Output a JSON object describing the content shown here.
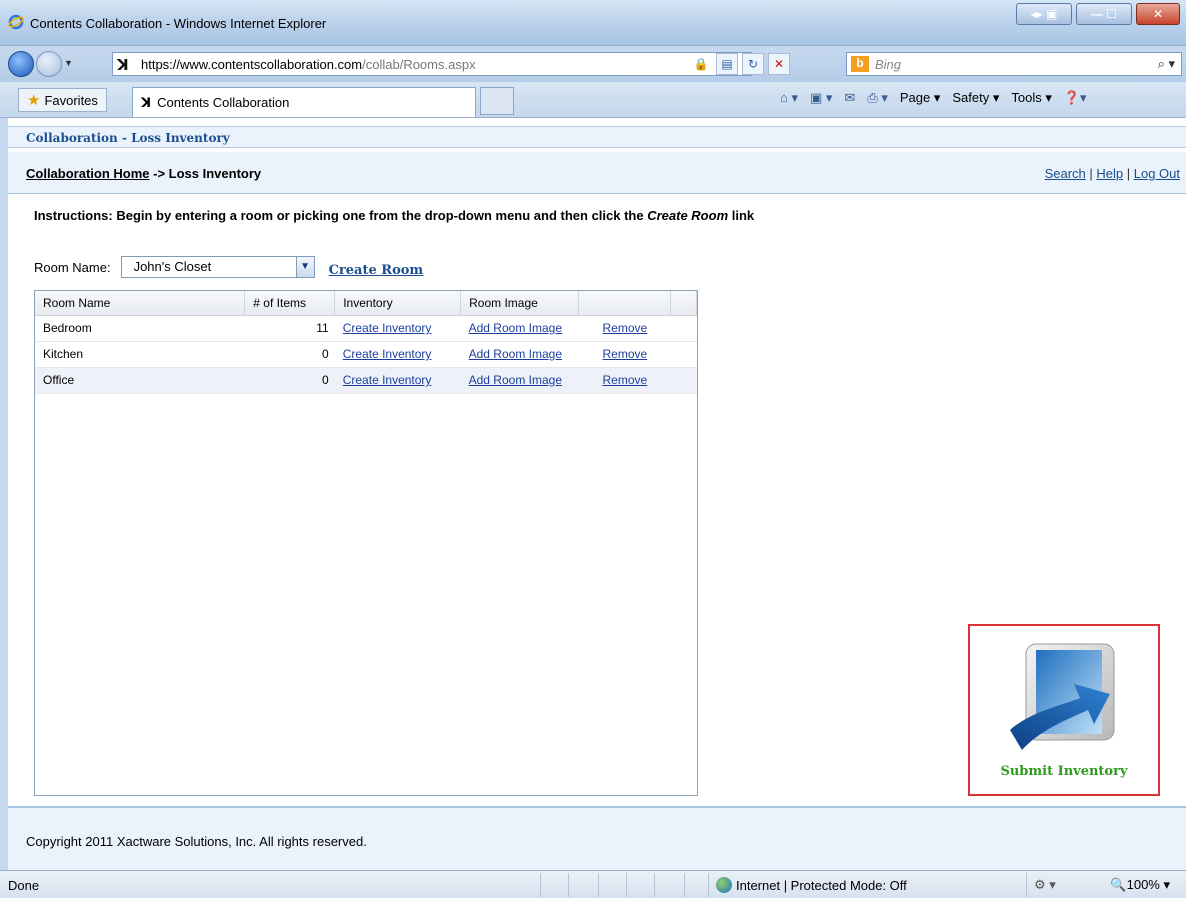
{
  "window": {
    "title": "Contents Collaboration - Windows Internet Explorer"
  },
  "address": {
    "url_prefix": "https://",
    "url_domain": "www.contentscollaboration.com",
    "url_path": "/collab/Rooms.aspx"
  },
  "search": {
    "placeholder": "Bing"
  },
  "favorites": {
    "label": "Favorites"
  },
  "tab": {
    "label": "Contents Collaboration"
  },
  "command_bar": {
    "page": "Page ▾",
    "safety": "Safety ▾",
    "tools": "Tools ▾"
  },
  "app": {
    "section_title": "Collaboration - Loss Inventory",
    "breadcrumb": {
      "home": "Collaboration Home",
      "separator": " -> ",
      "current": "Loss Inventory"
    },
    "links": {
      "search": "Search",
      "help": "Help",
      "logout": "Log Out",
      "divider": " | "
    },
    "instructions": {
      "text": "Instructions: Begin by entering a room or picking one from the drop-down menu and then click the ",
      "emphasis": "Create Room",
      "suffix": " link"
    },
    "room_name_label": "Room Name:",
    "room_name_value": "John's Closet",
    "create_room_label": "Create Room",
    "table": {
      "headers": [
        "Room Name",
        "# of Items",
        "Inventory",
        "Room Image",
        ""
      ],
      "rows": [
        {
          "name": "Bedroom",
          "items": "11",
          "inventory": "Create Inventory",
          "image": "Add Room Image",
          "remove": "Remove"
        },
        {
          "name": "Kitchen",
          "items": "0",
          "inventory": "Create Inventory",
          "image": "Add Room Image",
          "remove": "Remove"
        },
        {
          "name": "Office",
          "items": "0",
          "inventory": "Create Inventory",
          "image": "Add Room Image",
          "remove": "Remove"
        }
      ]
    },
    "submit_label": "Submit Inventory",
    "copyright": "Copyright 2011 Xactware Solutions, Inc. All rights reserved."
  },
  "status": {
    "text": "Done",
    "zone": "Internet | Protected Mode: Off",
    "zoom": "100%"
  }
}
